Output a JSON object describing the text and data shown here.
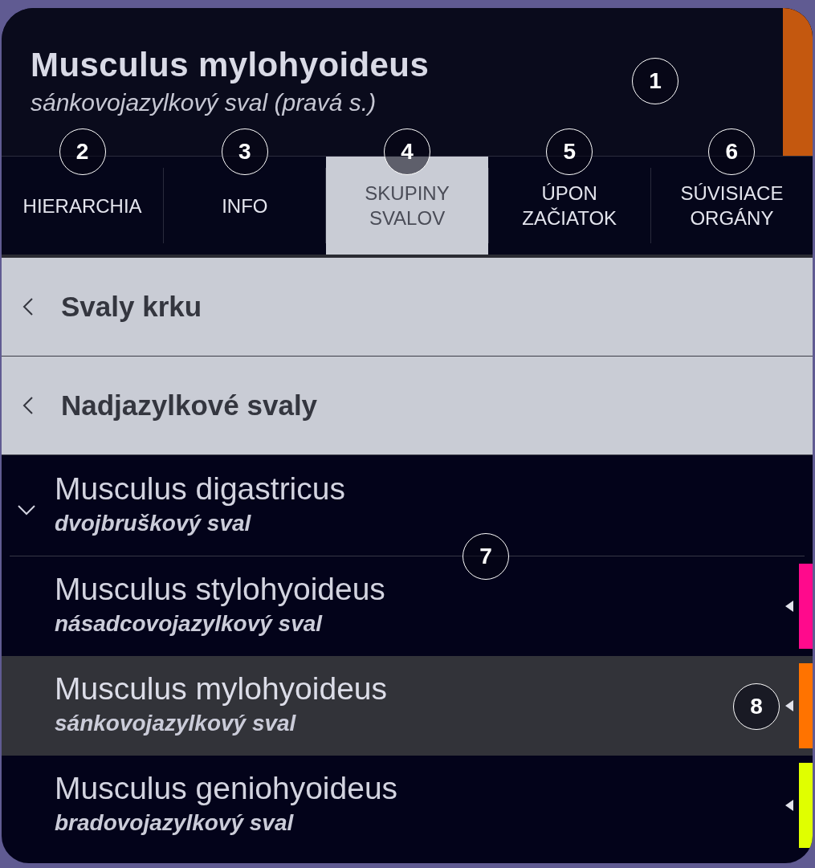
{
  "header": {
    "title": "Musculus mylohyoideus",
    "subtitle": "sánkovojazylkový sval (pravá s.)",
    "color": "#c4580f",
    "callout": "1"
  },
  "tabs": [
    {
      "label": "HIERARCHIA",
      "selected": false,
      "callout": "2"
    },
    {
      "label": "INFO",
      "selected": false,
      "callout": "3"
    },
    {
      "label": "SKUPINY SVALOV",
      "selected": true,
      "callout": "4"
    },
    {
      "label": "ÚPON ZAČIATOK",
      "selected": false,
      "callout": "5"
    },
    {
      "label": "SÚVISIACE ORGÁNY",
      "selected": false,
      "callout": "6"
    }
  ],
  "groups": [
    {
      "label": "Svaly krku"
    },
    {
      "label": "Nadjazylkové svaly"
    }
  ],
  "muscles": [
    {
      "name": "Musculus digastricus",
      "translation": "dvojbruškový sval",
      "selected": false,
      "expanded": true,
      "callout": "7",
      "children": [
        {
          "name": "Musculus stylohyoideus",
          "translation": "násadcovojazylkový sval",
          "color": "#ff0a8c",
          "selected": false
        },
        {
          "name": "Musculus mylohyoideus",
          "translation": "sánkovojazylkový sval",
          "color": "#ff7300",
          "selected": true,
          "callout": "8"
        },
        {
          "name": "Musculus geniohyoideus",
          "translation": "bradovojazylkový sval",
          "color": "#e0ff00",
          "selected": false
        }
      ]
    }
  ]
}
